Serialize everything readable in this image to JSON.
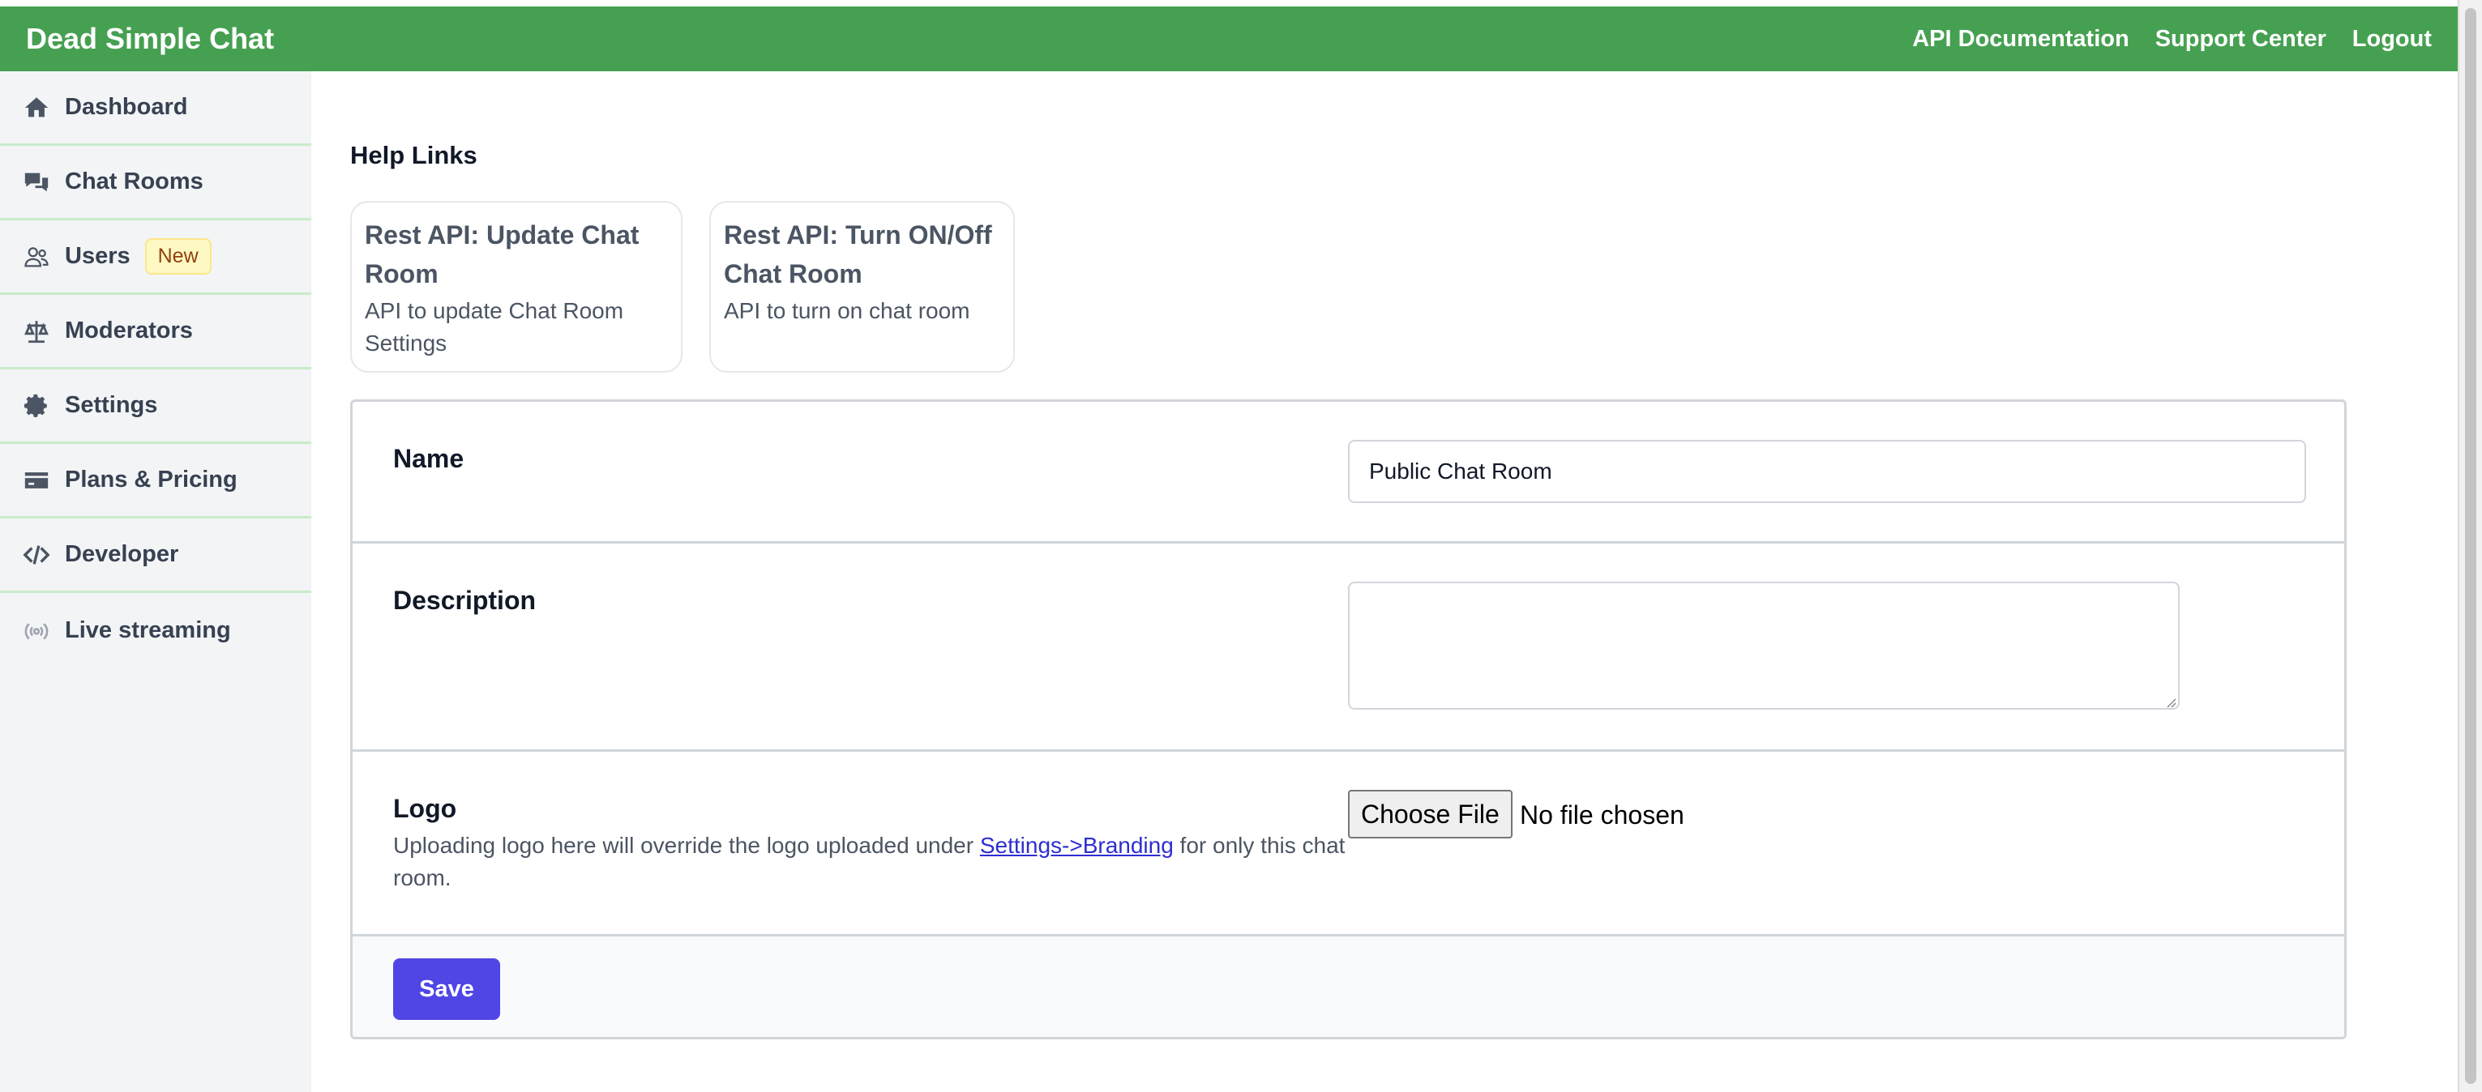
{
  "header": {
    "brand": "Dead Simple Chat",
    "links": [
      "API Documentation",
      "Support Center",
      "Logout"
    ],
    "bg_color": "#46a051"
  },
  "sidebar": {
    "items": [
      {
        "label": "Dashboard",
        "icon": "home-icon"
      },
      {
        "label": "Chat Rooms",
        "icon": "chat-bubbles-icon"
      },
      {
        "label": "Users",
        "icon": "users-icon",
        "badge": "New"
      },
      {
        "label": "Moderators",
        "icon": "scale-icon"
      },
      {
        "label": "Settings",
        "icon": "gear-icon"
      },
      {
        "label": "Plans & Pricing",
        "icon": "credit-card-icon"
      },
      {
        "label": "Developer",
        "icon": "code-icon"
      },
      {
        "label": "Live streaming",
        "icon": "broadcast-icon"
      }
    ]
  },
  "help": {
    "title": "Help Links",
    "cards": [
      {
        "title": "Rest API: Update Chat Room",
        "description": "API to update Chat Room Settings"
      },
      {
        "title": "Rest API: Turn ON/Off Chat Room",
        "description": "API to turn on chat room"
      }
    ]
  },
  "form": {
    "name": {
      "label": "Name",
      "value": "Public Chat Room"
    },
    "description": {
      "label": "Description",
      "value": ""
    },
    "logo": {
      "label": "Logo",
      "help_prefix": "Uploading logo here will override the logo uploaded under ",
      "help_link": "Settings->Branding",
      "help_suffix": " for only this chat room.",
      "button_label": "Choose File",
      "status": "No file chosen"
    },
    "save_label": "Save",
    "accent_color": "#4f46e5"
  }
}
